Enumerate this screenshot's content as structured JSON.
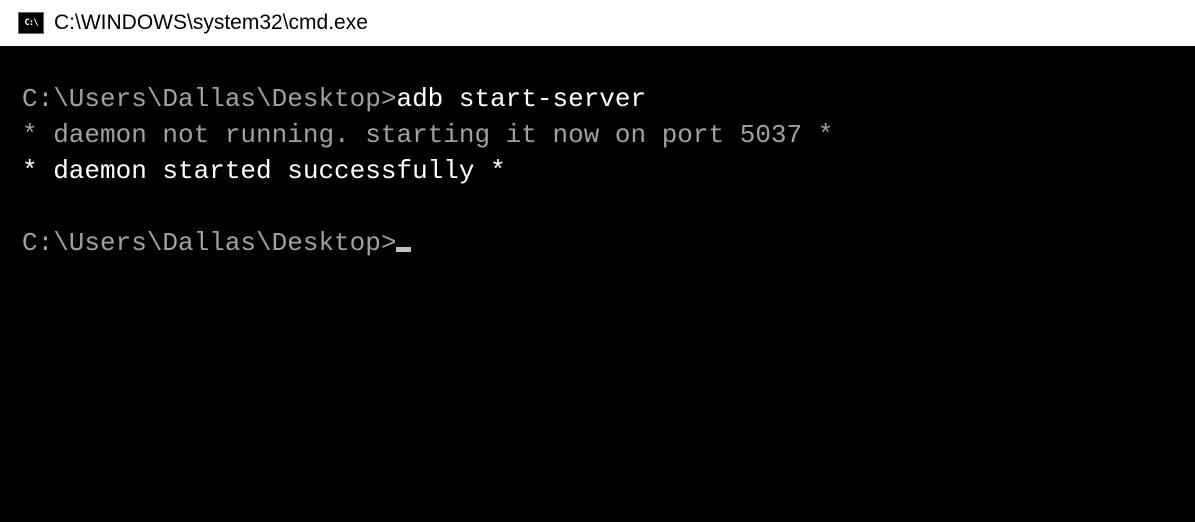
{
  "titlebar": {
    "icon_label": "C:\\",
    "path": "C:\\WINDOWS\\system32\\cmd.exe"
  },
  "terminal": {
    "prompt1": "C:\\Users\\Dallas\\Desktop>",
    "command1": "adb start-server",
    "output_line1": "* daemon not running. starting it now on port 5037 *",
    "output_line2": "* daemon started successfully *",
    "prompt2": "C:\\Users\\Dallas\\Desktop>"
  }
}
